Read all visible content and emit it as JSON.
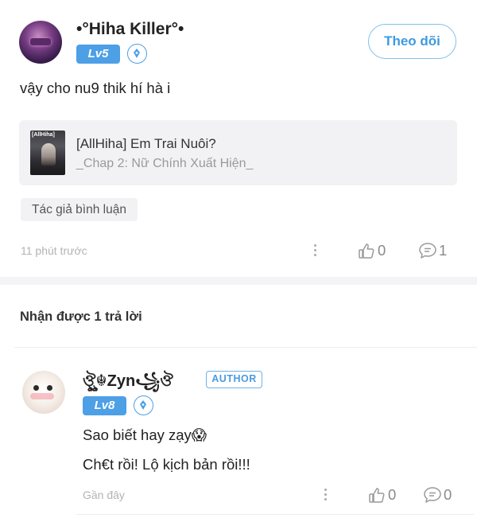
{
  "comment": {
    "username": "•°Hiha Killer°•",
    "level": "Lv5",
    "follow_label": "Theo dõi",
    "text": "vậy cho nu9 thik hí hà i",
    "story": {
      "cover_text": "[AllHiha]",
      "title": "[AllHiha] Em Trai Nuôi?",
      "chapter": "_Chap 2: Nữ Chính Xuất Hiện_"
    },
    "tag": "Tác giả bình luận",
    "time": "11 phút trước",
    "likes": "0",
    "replies": "1"
  },
  "replies_heading": "Nhận được 1 trả lời",
  "reply": {
    "username": "ঔৣ☬Zyn꧁ঔ",
    "author_label": "AUTHOR",
    "level": "Lv8",
    "line1": "Sao biết hay zạy😱",
    "line2": "Ch€t rồi! Lộ kịch bản rồi!!!",
    "time": "Gần đây",
    "likes": "0",
    "replies": "0"
  },
  "colors": {
    "accent": "#4d9fe6",
    "follow_text": "#3e9ae0",
    "muted": "#b3b3b3",
    "card_bg": "#f2f2f4"
  },
  "icons": [
    "pen-badge-icon",
    "more-icon",
    "like-icon",
    "comment-icon"
  ]
}
